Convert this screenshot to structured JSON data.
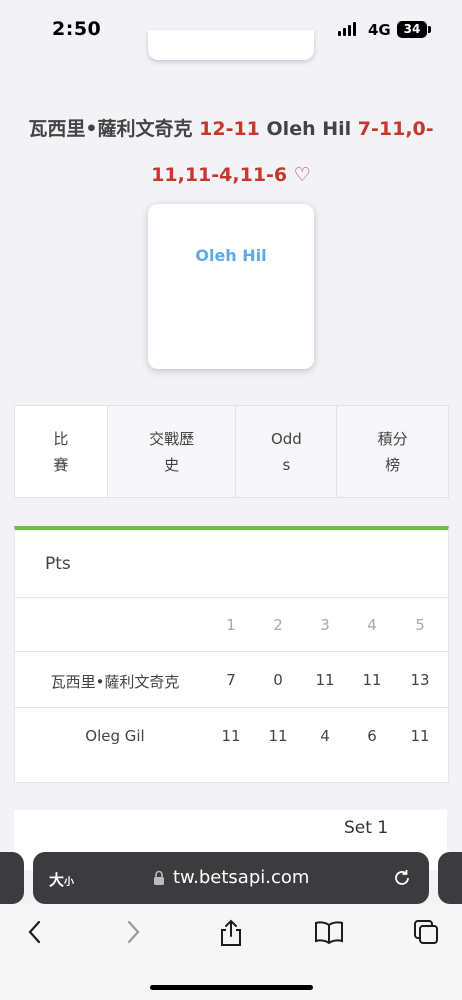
{
  "status": {
    "time": "2:50",
    "network": "4G",
    "battery": "34"
  },
  "match": {
    "home": "瓦西里•薩利文奇克",
    "set_score": "12-11",
    "away": "Oleh Hil",
    "set_scores_line1": "7-11,0-",
    "set_scores_line2": "11,11-4,11-6"
  },
  "team_card": {
    "name": "Oleh Hil"
  },
  "tabs": [
    {
      "l1": "比",
      "l2": "賽"
    },
    {
      "l1": "交戰歷",
      "l2": "史"
    },
    {
      "l1": "Odd",
      "l2": "s"
    },
    {
      "l1": "積分",
      "l2": "榜"
    }
  ],
  "points": {
    "title": "Pts",
    "headers": [
      "1",
      "2",
      "3",
      "4",
      "5"
    ],
    "rows": [
      {
        "name": "瓦西里•薩利文奇克",
        "values": [
          "7",
          "0",
          "11",
          "11",
          "13"
        ]
      },
      {
        "name": "Oleg Gil",
        "values": [
          "11",
          "11",
          "4",
          "6",
          "11"
        ]
      }
    ]
  },
  "set_section": {
    "label": "Set 1"
  },
  "browser": {
    "text_size": "大",
    "text_size_small": "小",
    "url": "tw.betsapi.com"
  }
}
